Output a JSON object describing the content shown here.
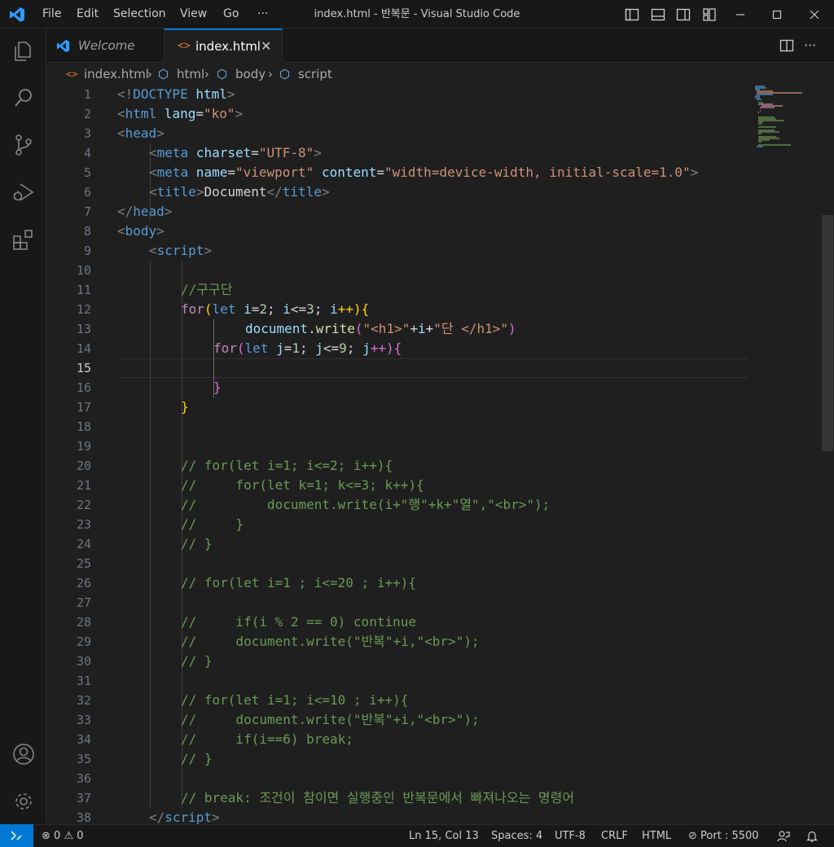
{
  "titlebar": {
    "menus": [
      "File",
      "Edit",
      "Selection",
      "View",
      "Go",
      "···"
    ],
    "title": "index.html - 반복문 - Visual Studio Code"
  },
  "tabs": [
    {
      "label": "Welcome",
      "icon": "vscode-icon"
    },
    {
      "label": "index.html",
      "icon": "html-icon",
      "active": true
    }
  ],
  "breadcrumb": [
    "index.html",
    "html",
    "body",
    "script"
  ],
  "line_numbers": [
    "1",
    "2",
    "3",
    "4",
    "5",
    "6",
    "7",
    "8",
    "9",
    "10",
    "11",
    "12",
    "13",
    "14",
    "15",
    "16",
    "17",
    "18",
    "19",
    "20",
    "21",
    "22",
    "23",
    "24",
    "25",
    "26",
    "27",
    "28",
    "29",
    "30",
    "31",
    "32",
    "33",
    "34",
    "35",
    "36",
    "37",
    "38"
  ],
  "current_line": "15",
  "code": {
    "l1": {
      "a": "<!",
      "b": "DOCTYPE",
      "c": " html",
      "d": ">"
    },
    "l2": {
      "a": "<",
      "b": "html",
      "c": " lang",
      "d": "=",
      "e": "\"ko\"",
      "f": ">"
    },
    "l3": {
      "a": "<",
      "b": "head",
      "c": ">"
    },
    "l4": {
      "a": "<",
      "b": "meta",
      "c": " charset",
      "d": "=",
      "e": "\"UTF-8\"",
      "f": ">"
    },
    "l5": {
      "a": "<",
      "b": "meta",
      "c": " name",
      "d": "=",
      "e": "\"viewport\"",
      "f": " content",
      "g": "=",
      "h": "\"width=device-width, initial-scale=1.0\"",
      "i": ">"
    },
    "l6": {
      "a": "<",
      "b": "title",
      "c": ">",
      "d": "Document",
      "e": "</",
      "f": "title",
      "g": ">"
    },
    "l7": {
      "a": "</",
      "b": "head",
      "c": ">"
    },
    "l8": {
      "a": "<",
      "b": "body",
      "c": ">"
    },
    "l9": {
      "a": "<",
      "b": "script",
      "c": ">"
    },
    "l11": "//구구단",
    "l12": {
      "a": "for",
      "b": "(",
      "c": "let",
      "d": " i",
      "e": "=",
      "f": "2",
      "g": "; ",
      "h": "i",
      "i": "<=",
      "j": "3",
      "k": "; ",
      "l": "i",
      "m": "++)",
      "n": "{"
    },
    "l13": {
      "a": "document",
      "b": ".",
      "c": "write",
      "d": "(",
      "e": "\"<h1>\"",
      "f": "+",
      "g": "i",
      "h": "+",
      "i": "\"단 </h1>\"",
      "j": ")"
    },
    "l14": {
      "a": "for",
      "b": "(",
      "c": "let",
      "d": " j",
      "e": "=",
      "f": "1",
      "g": "; ",
      "h": "j",
      "i": "<=",
      "j": "9",
      "k": "; ",
      "l": "j",
      "m": "++)",
      "n": "{"
    },
    "l16": "}",
    "l17": "}",
    "l20": "// for(let i=1; i<=2; i++){",
    "l21": "//     for(let k=1; k<=3; k++){",
    "l22": "//         document.write(i+\"행\"+k+\"열\",\"<br>\");",
    "l23": "//     }",
    "l24": "// }",
    "l26": "// for(let i=1 ; i<=20 ; i++){",
    "l28": "//     if(i % 2 == 0) continue",
    "l29": "//     document.write(\"반복\"+i,\"<br>\");",
    "l30": "// }",
    "l32": "// for(let i=1; i<=10 ; i++){",
    "l33": "//     document.write(\"반복\"+i,\"<br>\");",
    "l34": "//     if(i==6) break;",
    "l35": "// }",
    "l37": "// break: 조건이 참이면 실행중인 반복문에서 빠져나오는 명령어",
    "l38": {
      "a": "</",
      "b": "script",
      "c": ">"
    }
  },
  "statusbar": {
    "errors": "0",
    "warnings": "0",
    "position": "Ln 15, Col 13",
    "spaces": "Spaces: 4",
    "encoding": "UTF-8",
    "eol": "CRLF",
    "language": "HTML",
    "port": "Port : 5500"
  },
  "colors": {
    "accent": "#0078d4",
    "keyword": "#c586c0",
    "tag": "#569cd6",
    "string": "#ce9178",
    "comment": "#6a9955"
  }
}
